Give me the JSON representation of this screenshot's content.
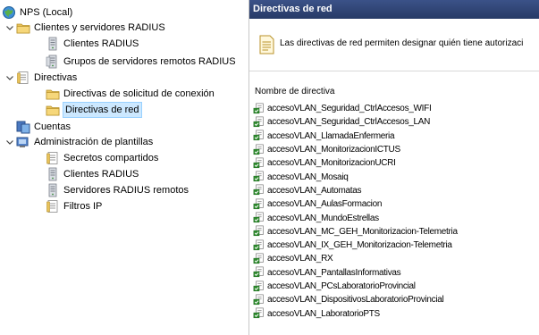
{
  "tree": {
    "root": "NPS (Local)",
    "clients_group": "Clientes y servidores RADIUS",
    "clients": "Clientes RADIUS",
    "remote_groups": "Grupos de servidores remotos RADIUS",
    "policies": "Directivas",
    "conn_policies": "Directivas de solicitud de conexión",
    "net_policies": "Directivas de red",
    "accounts": "Cuentas",
    "templates": "Administración de plantillas",
    "shared_secrets": "Secretos compartidos",
    "tpl_clients": "Clientes RADIUS",
    "tpl_servers": "Servidores RADIUS remotos",
    "ip_filters": "Filtros IP"
  },
  "panel": {
    "title": "Directivas de red",
    "description": "Las directivas de red permiten designar quién tiene autorizaci",
    "column_header": "Nombre de directiva"
  },
  "policies": [
    "accesoVLAN_Seguridad_CtrlAccesos_WIFI",
    "accesoVLAN_Seguridad_CtrlAccesos_LAN",
    "accesoVLAN_LlamadaEnfermeria",
    "accesoVLAN_MonitorizacionICTUS",
    "accesoVLAN_MonitorizacionUCRI",
    "accesoVLAN_Mosaiq",
    "accesoVLAN_Automatas",
    "accesoVLAN_AulasFormacion",
    "accesoVLAN_MundoEstrellas",
    "accesoVLAN_MC_GEH_Monitorizacion-Telemetria",
    "accesoVLAN_IX_GEH_Monitorizacion-Telemetria",
    "accesoVLAN_RX",
    "accesoVLAN_PantallasInformativas",
    "accesoVLAN_PCsLaboratorioProvincial",
    "accesoVLAN_DispositivosLaboratorioProvincial",
    "accesoVLAN_LaboratorioPTS"
  ],
  "colors": {
    "title_bar": "#2c3e66",
    "selection": "#cce8ff",
    "policy_icon": "#2e8b2e"
  }
}
